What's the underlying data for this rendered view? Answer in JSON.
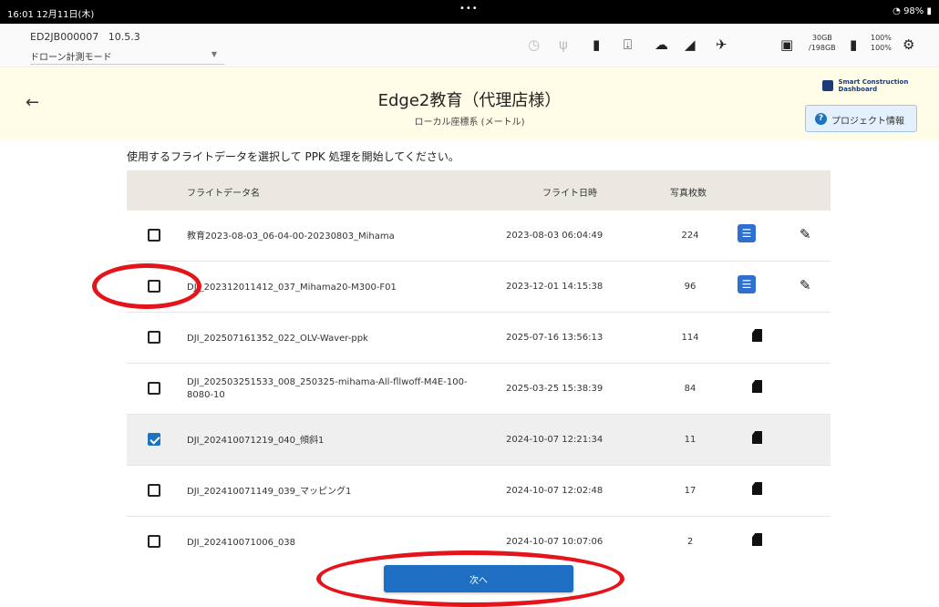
{
  "status_bar": {
    "time": "16:01  12月11日(木)",
    "dots": "•••",
    "battery": "98%"
  },
  "device": {
    "id": "ED2JB000007",
    "version": "10.5.3",
    "mode": "ドローン計測モード"
  },
  "toolbar": {
    "storage_top": "30GB",
    "storage_bottom": "/198GB",
    "pct_top": "100%",
    "pct_bottom": "100%"
  },
  "project": {
    "title": "Edge2教育（代理店様）",
    "subtitle": "ローカル座標系 (メートル)",
    "brand_line1": "Smart Construction",
    "brand_line2": "Dashboard",
    "info_button": "プロジェクト情報"
  },
  "instruction": "使用するフライトデータを選択して PPK 処理を開始してください。",
  "table": {
    "headers": {
      "name": "フライトデータ名",
      "date": "フライト日時",
      "count": "写真枚数"
    },
    "rows": [
      {
        "name": "教育2023-08-03_06-04-00-20230803_Mihama",
        "date": "2023-08-03 06:04:49",
        "count": "224",
        "checked": false,
        "source": "cloud-db-icon",
        "editable": true
      },
      {
        "name": "DJI_202312011412_037_Mihama20-M300-F01",
        "date": "2023-12-01 14:15:38",
        "count": "96",
        "checked": false,
        "source": "cloud-db-icon",
        "editable": true
      },
      {
        "name": "DJI_202507161352_022_OLV-Waver-ppk",
        "date": "2025-07-16 13:56:13",
        "count": "114",
        "checked": false,
        "source": "sd-card-icon",
        "editable": false
      },
      {
        "name": "DJI_202503251533_008_250325-mihama-All-fllwoff-M4E-100-8080-10",
        "date": "2025-03-25 15:38:39",
        "count": "84",
        "checked": false,
        "source": "sd-card-icon",
        "editable": false
      },
      {
        "name": "DJI_202410071219_040_傾斜1",
        "date": "2024-10-07 12:21:34",
        "count": "11",
        "checked": true,
        "source": "sd-card-icon",
        "editable": false
      },
      {
        "name": "DJI_202410071149_039_マッピング1",
        "date": "2024-10-07 12:02:48",
        "count": "17",
        "checked": false,
        "source": "sd-card-icon",
        "editable": false
      },
      {
        "name": "DJI_202410071006_038",
        "date": "2024-10-07 10:07:06",
        "count": "2",
        "checked": false,
        "source": "sd-card-icon",
        "editable": false
      }
    ]
  },
  "next_button": "次へ",
  "colors": {
    "accent": "#1e6ec4",
    "annotation": "#e5141b",
    "header_bg": "#fffde8"
  }
}
